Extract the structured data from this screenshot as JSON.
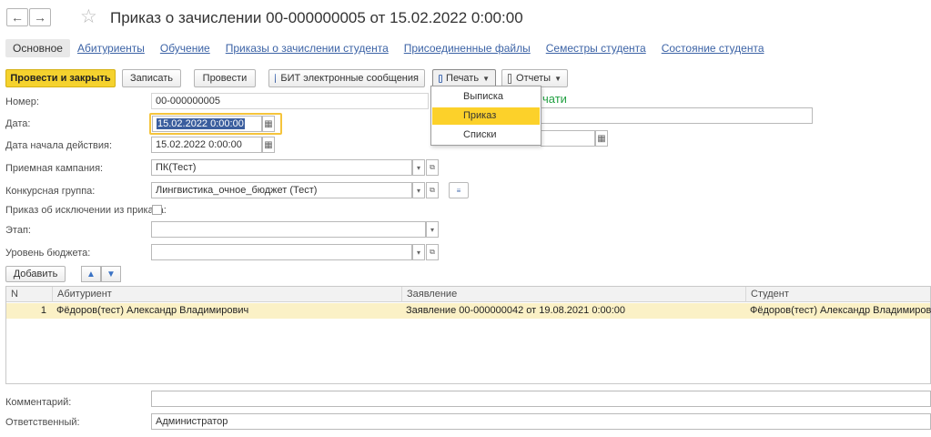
{
  "window": {
    "title": "Приказ о зачислении 00-000000005 от 15.02.2022 0:00:00",
    "back_icon": "←",
    "forward_icon": "→",
    "star_icon": "☆"
  },
  "tabs": {
    "active": "Основное",
    "links": [
      "Абитуриенты",
      "Обучение",
      "Приказы о зачислении студента",
      "Присоединенные файлы",
      "Семестры студента",
      "Состояние студента"
    ]
  },
  "toolbar": {
    "post_close": "Провести и закрыть",
    "save": "Записать",
    "post": "Провести",
    "bit_messages": "БИТ электронные сообщения",
    "print": "Печать",
    "reports": "Отчеты"
  },
  "print_menu": {
    "items": [
      "Выписка",
      "Приказ",
      "Списки"
    ],
    "active": "Приказ",
    "partial_text": "чати"
  },
  "form": {
    "number_label": "Номер:",
    "number_value": "00-000000005",
    "date_label": "Дата:",
    "date_value": "15.02.2022  0:00:00",
    "start_label": "Дата начала действия:",
    "start_value": "15.02.2022  0:00:00",
    "campaign_label": "Приемная кампания:",
    "campaign_value": "ПК(Тест)",
    "group_label": "Конкурсная группа:",
    "group_value": "Лингвистика_очное_бюджет (Тест)",
    "exclusion_label": "Приказ об исключении из приказа:",
    "exclusion_checked": false,
    "stage_label": "Этап:",
    "stage_value": "",
    "budget_label": "Уровень бюджета:",
    "budget_value": ""
  },
  "table_toolbar": {
    "add": "Добавить"
  },
  "table": {
    "columns": [
      "N",
      "Абитуриент",
      "Заявление",
      "Студент"
    ],
    "rows": [
      {
        "n": "1",
        "applicant": "Фёдоров(тест) Александр Владимирович",
        "application": "Заявление 00-000000042 от 19.08.2021 0:00:00",
        "student": "Фёдоров(тест) Александр Владимирович"
      }
    ]
  },
  "footer": {
    "comment_label": "Комментарий:",
    "comment_value": "",
    "responsible_label": "Ответственный:",
    "responsible_value": "Администратор"
  },
  "colors": {
    "accent_yellow": "#f5d22e",
    "link_blue": "#3c63a6",
    "selected_row": "#fbf1c6",
    "green_text": "#22a042"
  }
}
